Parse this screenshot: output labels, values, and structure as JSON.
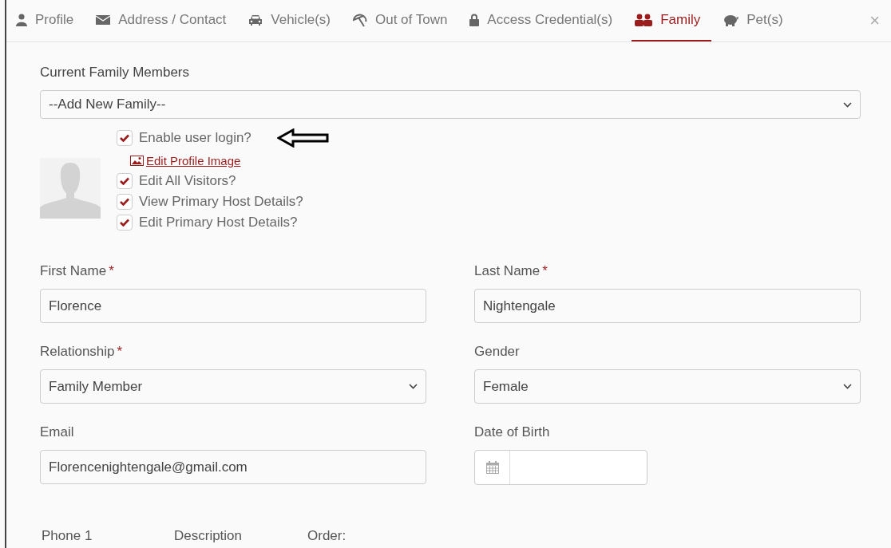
{
  "tabs": [
    {
      "label": "Profile",
      "selected": false
    },
    {
      "label": "Address / Contact",
      "selected": false
    },
    {
      "label": "Vehicle(s)",
      "selected": false
    },
    {
      "label": "Out of Town",
      "selected": false
    },
    {
      "label": "Access Credential(s)",
      "selected": false
    },
    {
      "label": "Family",
      "selected": true
    },
    {
      "label": "Pet(s)",
      "selected": false
    }
  ],
  "close": "×",
  "members": {
    "label": "Current Family Members",
    "value": "--Add New Family--"
  },
  "login": {
    "label": "Enable user login?",
    "checked": true
  },
  "profile_image_link": "Edit Profile Image",
  "permissions": [
    {
      "label": "Edit All Visitors?",
      "checked": true
    },
    {
      "label": "View Primary Host Details?",
      "checked": true
    },
    {
      "label": "Edit Primary Host Details?",
      "checked": true
    }
  ],
  "fields": [
    {
      "kind": "text",
      "label": "First Name",
      "required_mark": "*",
      "value": "Florence"
    },
    {
      "kind": "text",
      "label": "Last Name",
      "required_mark": "*",
      "value": "Nightengale"
    },
    {
      "kind": "select",
      "label": "Relationship",
      "required_mark": "*",
      "value": "Family Member"
    },
    {
      "kind": "select",
      "label": "Gender",
      "value": "Female"
    },
    {
      "kind": "text",
      "label": "Email",
      "value": "Florencenightengale@gmail.com"
    },
    {
      "kind": "date",
      "label": "Date of Birth"
    }
  ],
  "phone_headers": [
    "Phone 1",
    "Description",
    "Order:"
  ]
}
